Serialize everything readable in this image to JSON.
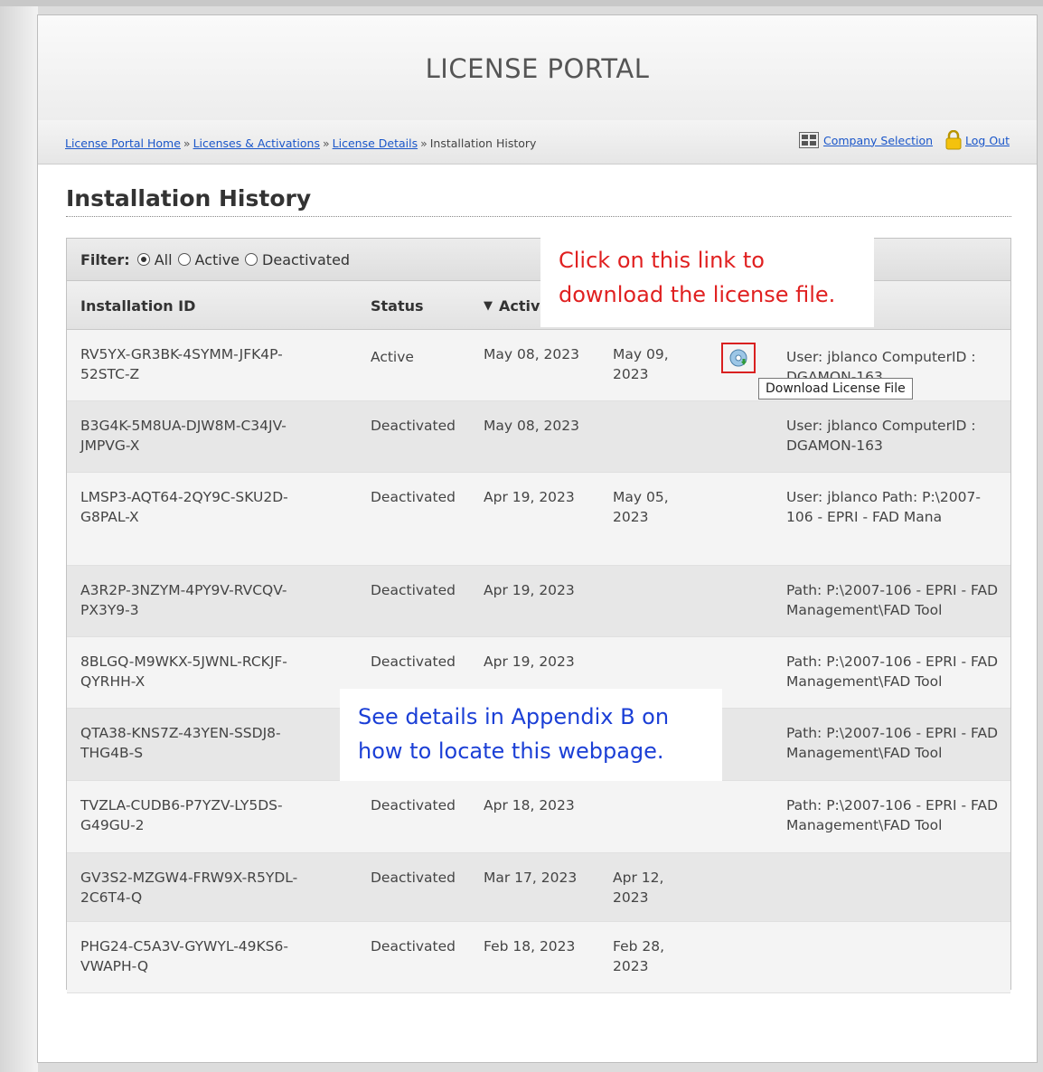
{
  "header": {
    "title": "LICENSE PORTAL"
  },
  "breadcrumbs": {
    "home": "License Portal Home",
    "sep": "»",
    "licenses": "Licenses & Activations",
    "details": "License Details",
    "current": "Installation History"
  },
  "nav": {
    "company_selection": "Company Selection",
    "logout": "Log Out"
  },
  "page_title": "Installation History",
  "filter": {
    "label": "Filter:",
    "options": [
      "All",
      "Active",
      "Deactivated"
    ],
    "selected": "All"
  },
  "columns": {
    "id": "Installation ID",
    "status": "Status",
    "activated": "Activ",
    "sort_indicator": "▼"
  },
  "rows": [
    {
      "id": "RV5YX-GR3BK-4SYMM-JFK4P-52STC-Z",
      "status": "Active",
      "activated": "May 08, 2023",
      "deactivated": "May 09, 2023",
      "info": "User: jblanco ComputerID : DGAMON-163"
    },
    {
      "id": "B3G4K-5M8UA-DJW8M-C34JV-JMPVG-X",
      "status": "Deactivated",
      "activated": "May 08, 2023",
      "deactivated": "",
      "info": "User: jblanco ComputerID : DGAMON-163"
    },
    {
      "id": "LMSP3-AQT64-2QY9C-SKU2D-G8PAL-X",
      "status": "Deactivated",
      "activated": "Apr 19, 2023",
      "deactivated": "May 05, 2023",
      "info": "User: jblanco Path: P:\\2007-106 - EPRI - FAD Mana"
    },
    {
      "id": "A3R2P-3NZYM-4PY9V-RVCQV-PX3Y9-3",
      "status": "Deactivated",
      "activated": "Apr 19, 2023",
      "deactivated": "",
      "info": "Path: P:\\2007-106 - EPRI - FAD Management\\FAD Tool"
    },
    {
      "id": "8BLGQ-M9WKX-5JWNL-RCKJF-QYRHH-X",
      "status": "Deactivated",
      "activated": "Apr 19, 2023",
      "deactivated": "",
      "info": "Path: P:\\2007-106 - EPRI - FAD Management\\FAD Tool"
    },
    {
      "id": "QTA38-KNS7Z-43YEN-SSDJ8-THG4B-S",
      "status": "",
      "activated": "",
      "deactivated": "",
      "info": "Path: P:\\2007-106 - EPRI - FAD Management\\FAD Tool"
    },
    {
      "id": "TVZLA-CUDB6-P7YZV-LY5DS-G49GU-2",
      "status": "Deactivated",
      "activated": "Apr 18, 2023",
      "deactivated": "",
      "info": "Path: P:\\2007-106 - EPRI - FAD Management\\FAD Tool"
    },
    {
      "id": "GV3S2-MZGW4-FRW9X-R5YDL-2C6T4-Q",
      "status": "Deactivated",
      "activated": "Mar 17, 2023",
      "deactivated": "Apr 12, 2023",
      "info": ""
    },
    {
      "id": "PHG24-C5A3V-GYWYL-49KS6-VWAPH-Q",
      "status": "Deactivated",
      "activated": "Feb 18, 2023",
      "deactivated": "Feb 28, 2023",
      "info": ""
    }
  ],
  "tooltip": "Download License File",
  "callouts": {
    "download": [
      "Click on this link to",
      "download the license file."
    ],
    "appendix": [
      "See details in Appendix B on",
      "how to locate this webpage."
    ]
  },
  "icons": {
    "company_selection": "grid-icon",
    "logout": "lock-icon",
    "download": "download-disc-icon"
  },
  "colors": {
    "link": "#1a56c9",
    "callout_red": "#e02020",
    "callout_blue": "#1b3fd6"
  }
}
